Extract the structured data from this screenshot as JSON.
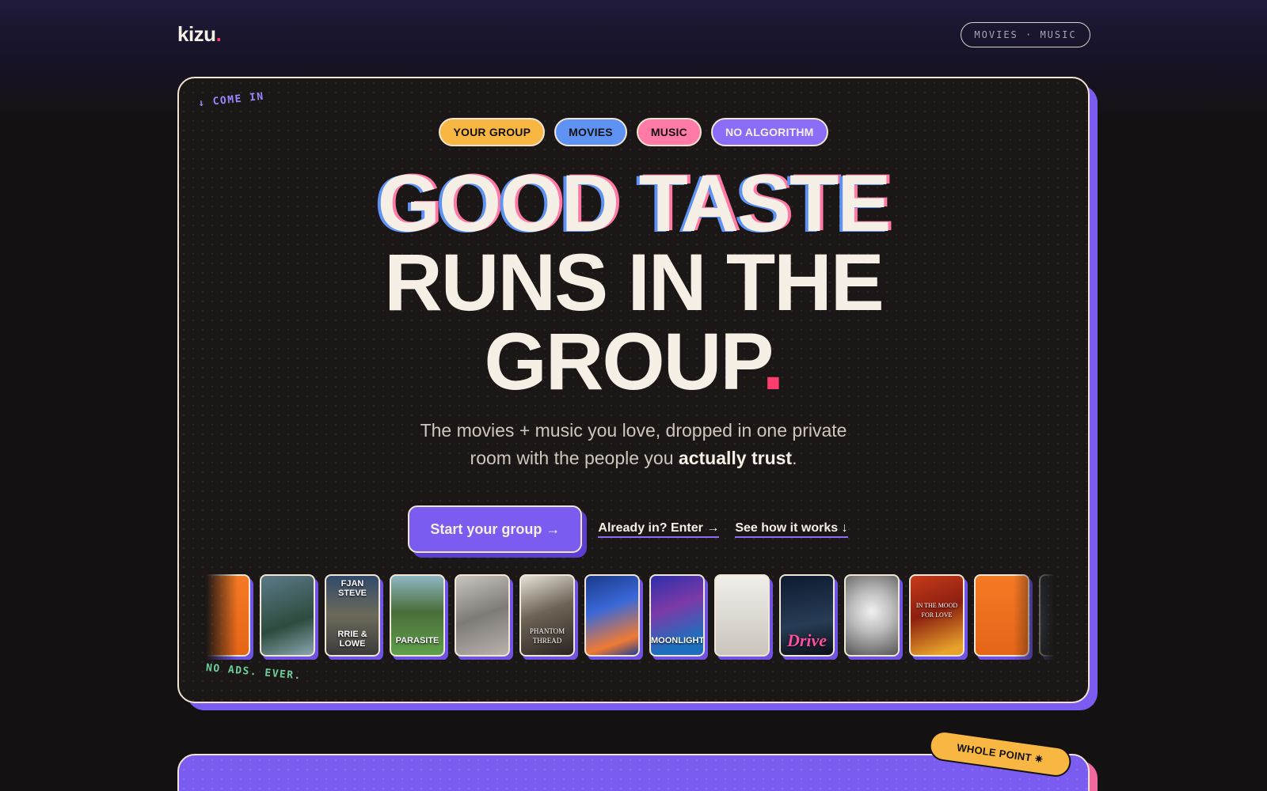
{
  "logo": {
    "text": "kizu",
    "dot": "."
  },
  "nav": {
    "pill_label": "MOVIES · MUSIC"
  },
  "hero": {
    "come_in": "↓ COME IN",
    "tags": [
      "YOUR GROUP",
      "MOVIES",
      "MUSIC",
      "NO ALGORITHM"
    ],
    "headline": {
      "line1": "GOOD TASTE",
      "line2": "RUNS IN THE",
      "line3": "GROUP",
      "period": "."
    },
    "subtitle": {
      "part1": "The movies + music you love, dropped in one private",
      "part2": "room with the people you ",
      "emphasis": "actually trust",
      "end": "."
    },
    "cta": {
      "primary": "Start your group →",
      "secondary": "Already in? Enter →",
      "tertiary": "See how it works ↓"
    },
    "cards": [
      {
        "name": "channel-orange-partial",
        "caption": ""
      },
      {
        "name": "street-scene",
        "caption": ""
      },
      {
        "name": "sufjan-stevens",
        "caption_top": "FJAN STEVE",
        "caption": "RRIE & LOWE"
      },
      {
        "name": "parasite",
        "caption": "PARASITE"
      },
      {
        "name": "grey-texture",
        "caption": ""
      },
      {
        "name": "phantom-thread",
        "caption": "PHANTOM THREAD"
      },
      {
        "name": "blue-painting",
        "caption": ""
      },
      {
        "name": "moonlight",
        "caption": "MOONLIGHT"
      },
      {
        "name": "pale-cover",
        "caption": ""
      },
      {
        "name": "drive",
        "caption": "Drive"
      },
      {
        "name": "moon-map",
        "caption": ""
      },
      {
        "name": "in-the-mood-for-love",
        "caption": "IN THE MOOD FOR LOVE"
      },
      {
        "name": "channel-orange",
        "caption": ""
      },
      {
        "name": "dark-partial",
        "caption": ""
      }
    ],
    "no_ads": "NO ADS. EVER."
  },
  "next_section": {
    "sticker": "WHOLE POINT ✷"
  },
  "colors": {
    "accent_purple": "#7b5cf0",
    "accent_pink": "#ff3d6e",
    "tag_yellow": "#f7b742",
    "tag_blue": "#5f93f3",
    "tag_pink": "#ff7aa6",
    "background": "#141112",
    "cream": "#f5efe6"
  }
}
